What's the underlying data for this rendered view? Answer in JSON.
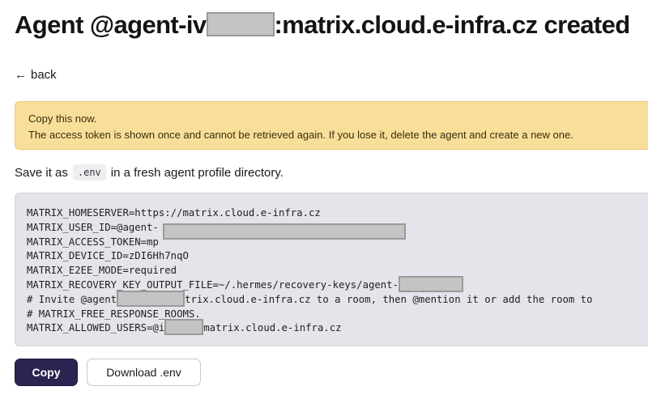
{
  "header": {
    "title_prefix": "Agent @agent-iv",
    "title_suffix": ":matrix.cloud.e-infra.cz created"
  },
  "nav": {
    "back_arrow": "←",
    "back_label": "back",
    "back_icon": "arrow-left-icon"
  },
  "warning": {
    "heading": "Copy this now.",
    "message": "The access token is shown once and cannot be retrieved again. If you lose it, delete the agent and create a new one.",
    "background": "#f8df99"
  },
  "instructions": {
    "prefix": "Save it as",
    "filename": ".env",
    "suffix": "in a fresh agent profile directory."
  },
  "env": {
    "homeserver": "MATRIX_HOMESERVER=https://matrix.cloud.e-infra.cz",
    "user_id_prefix": "MATRIX_USER_ID=@agent-",
    "access_token_prefix": "MATRIX_ACCESS_TOKEN=mp",
    "device_id": "MATRIX_DEVICE_ID=zDI6Hh7nqO",
    "e2ee_mode": "MATRIX_E2EE_MODE=required",
    "recovery_key_prefix": "MATRIX_RECOVERY_KEY_OUTPUT_FILE=~/.hermes/recovery-keys/agent-",
    "comment1_prefix": "# Invite @agent",
    "comment1_suffix": "trix.cloud.e-infra.cz to a room, then @mention it or add the room to",
    "comment2": "# MATRIX_FREE_RESPONSE_ROOMS.",
    "allowed_users_prefix": "MATRIX_ALLOWED_USERS=@i",
    "allowed_users_suffix": "matrix.cloud.e-infra.cz"
  },
  "actions": {
    "copy_label": "Copy",
    "download_label": "Download .env",
    "primary_color": "#2a2450"
  }
}
